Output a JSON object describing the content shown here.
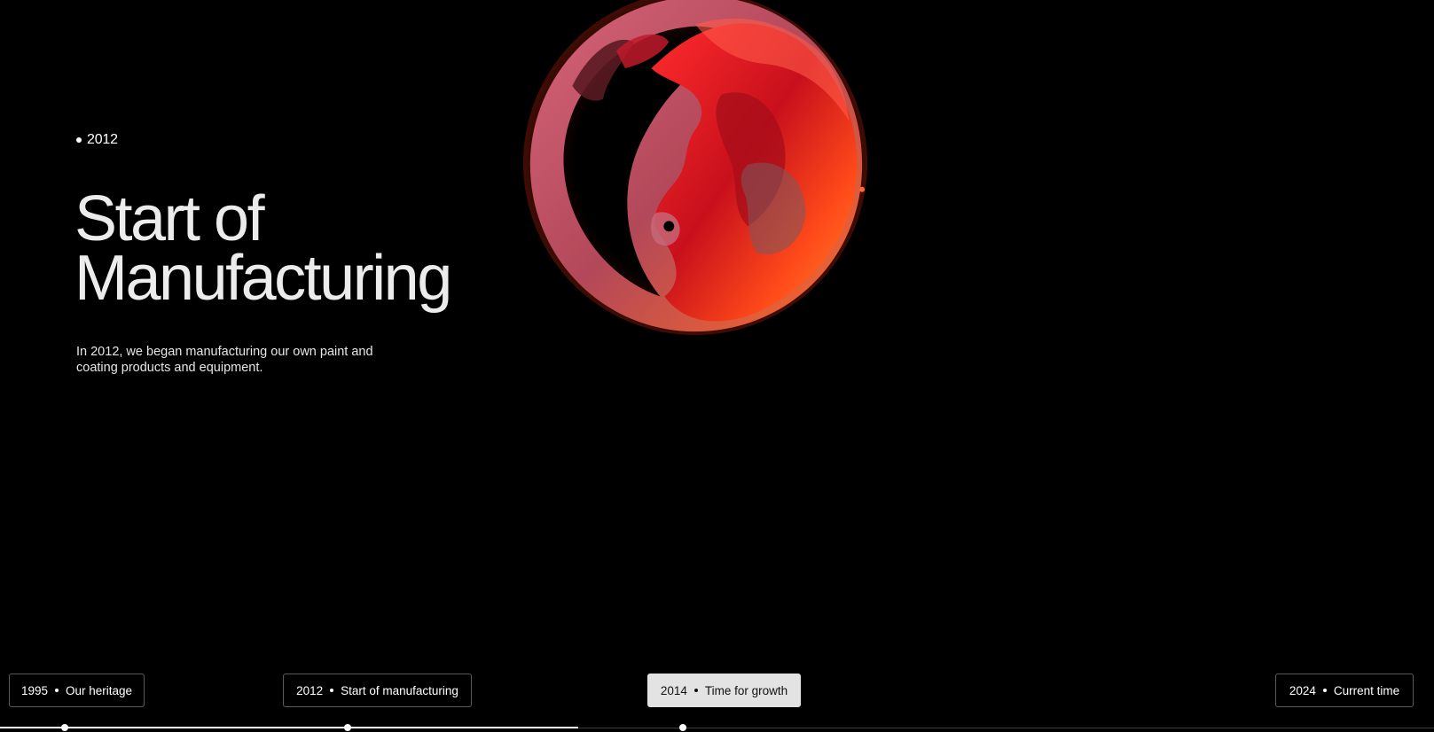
{
  "hero": {
    "year": "2012",
    "title_line1": "Start of",
    "title_line2": "Manufacturing",
    "description": "In 2012, we began manufacturing our own paint and coating products and equipment."
  },
  "timeline": {
    "progress_fraction": 0.403,
    "items": [
      {
        "year": "1995",
        "label": "Our heritage",
        "active": false
      },
      {
        "year": "2012",
        "label": "Start of manufacturing",
        "active": false
      },
      {
        "year": "2014",
        "label": "Time for growth",
        "active": true
      },
      {
        "year": "2024",
        "label": "Current time",
        "active": false
      }
    ]
  },
  "colors": {
    "background": "#000000",
    "text": "#ececec",
    "active_tab": "#e3e3e3",
    "orb_primary": "#e61e1e",
    "orb_secondary": "#ff6a1a"
  }
}
